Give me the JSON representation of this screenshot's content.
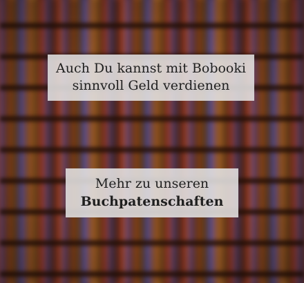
{
  "banner": {
    "headline_line1": "Auch Du kannst mit Bobooki",
    "headline_line2": "sinnvoll Geld verdienen",
    "cta_line1": "Mehr zu unseren",
    "cta_line2": "Buchpatenschaften"
  },
  "background": {
    "description_icon": "blurred-bookshelf-image"
  }
}
